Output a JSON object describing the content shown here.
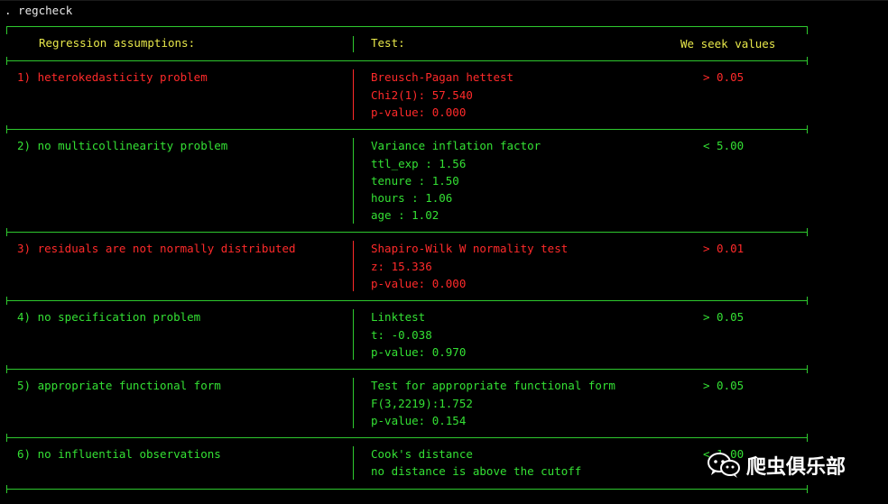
{
  "command": ". regcheck",
  "header": {
    "col1": "Regression assumptions:",
    "col2": "Test:",
    "col3": "We seek values"
  },
  "rows": [
    {
      "label": "1) heterokedasticity problem",
      "test": "Breusch-Pagan hettest",
      "details": [
        "Chi2(1): 57.540",
        "p-value: 0.000"
      ],
      "criterion": "> 0.05",
      "status": "red"
    },
    {
      "label": "2) no multicollinearity problem",
      "test": "Variance inflation factor",
      "details": [
        "ttl_exp : 1.56",
        "tenure : 1.50",
        "hours : 1.06",
        "age : 1.02"
      ],
      "criterion": "< 5.00",
      "status": "green"
    },
    {
      "label": "3) residuals are not normally distributed",
      "test": "Shapiro-Wilk W normality test",
      "details": [
        "z: 15.336",
        "p-value: 0.000"
      ],
      "criterion": "> 0.01",
      "status": "red"
    },
    {
      "label": "4) no specification problem",
      "test": "Linktest",
      "details": [
        "t: -0.038",
        "p-value: 0.970"
      ],
      "criterion": "> 0.05",
      "status": "green"
    },
    {
      "label": "5) appropriate functional form",
      "test": "Test for appropriate functional form",
      "details": [
        "F(3,2219):1.752",
        "p-value: 0.154"
      ],
      "criterion": "> 0.05",
      "status": "green"
    },
    {
      "label": "6) no influential observations",
      "test": "Cook's distance",
      "details": [
        "no distance is above the cutoff"
      ],
      "criterion": "< 1.00",
      "status": "green"
    }
  ],
  "watermark": {
    "text": "爬虫俱乐部",
    "icon": "wechat-logo-icon"
  },
  "colors": {
    "background": "#000000",
    "green": "#34e034",
    "red": "#ff2a2a",
    "yellow": "#e8e84a",
    "white": "#e8e8e8"
  }
}
